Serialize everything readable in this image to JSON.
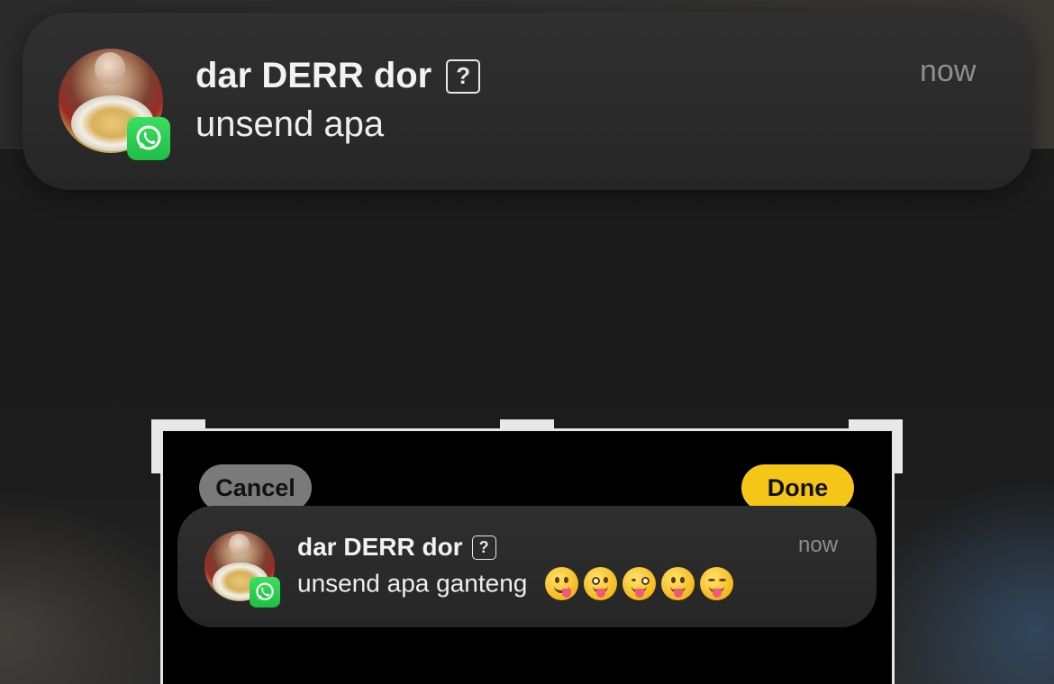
{
  "notification": {
    "sender": "dar DERR dor",
    "unknown_glyph": "?",
    "message": "unsend apa",
    "time": "now",
    "app_icon": "whatsapp-icon"
  },
  "editor": {
    "cancel_label": "Cancel",
    "done_label": "Done",
    "done_color": "#f5c518"
  },
  "preview_notification": {
    "sender": "dar DERR dor",
    "unknown_glyph": "?",
    "message": "unsend apa ganteng",
    "time": "now",
    "app_icon": "whatsapp-icon",
    "emojis": [
      "yum-face-icon",
      "zany-face-icon",
      "winking-tongue-face-icon",
      "tongue-face-icon",
      "squinting-tongue-face-icon"
    ]
  }
}
